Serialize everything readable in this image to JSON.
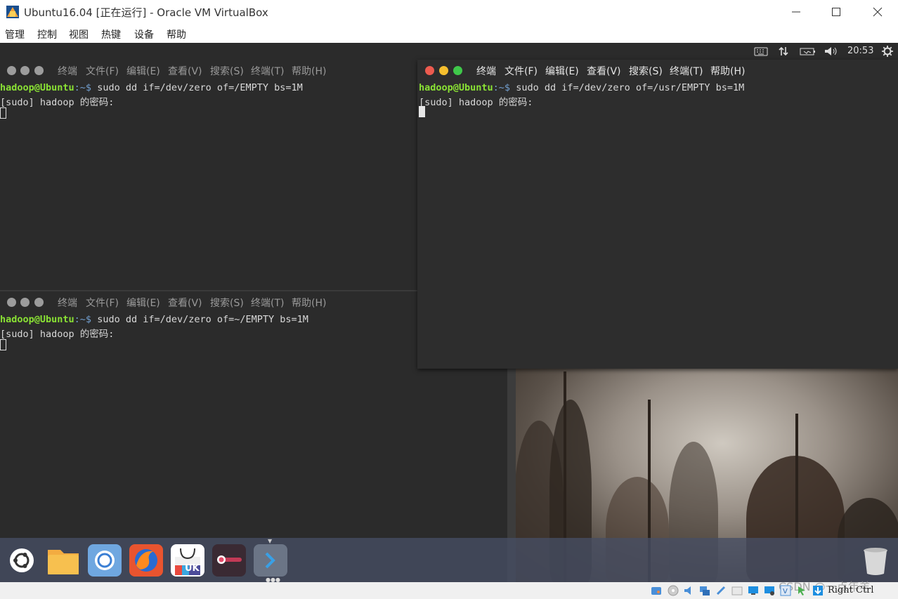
{
  "window": {
    "title": "Ubuntu16.04 [正在运行] - Oracle VM VirtualBox",
    "menu": [
      "管理",
      "控制",
      "视图",
      "热键",
      "设备",
      "帮助"
    ]
  },
  "panel": {
    "clock": "20:53"
  },
  "terminal_menu": [
    "终端",
    "文件(F)",
    "编辑(E)",
    "查看(V)",
    "搜索(S)",
    "终端(T)",
    "帮助(H)"
  ],
  "terminals": [
    {
      "prompt_user": "hadoop@Ubuntu",
      "prompt_path": ":~$",
      "command": " sudo dd if=/dev/zero of=/EMPTY bs=1M",
      "output": "[sudo] hadoop 的密码:"
    },
    {
      "prompt_user": "hadoop@Ubuntu",
      "prompt_path": ":~$",
      "command": " sudo dd if=/dev/zero of=~/EMPTY bs=1M",
      "output": "[sudo] hadoop 的密码:"
    },
    {
      "prompt_user": "hadoop@Ubuntu",
      "prompt_path": ":~$",
      "command": " sudo dd if=/dev/zero of=/usr/EMPTY bs=1M",
      "output": "[sudo] hadoop 的密码:"
    }
  ],
  "dock": {
    "badge": "UK"
  },
  "statusbar": {
    "host_key": "Right Ctrl",
    "watermark": "CSDN @一点年羊"
  },
  "colors": {
    "user_green": "#8ae234",
    "path_blue": "#729fcf",
    "close_red": "#ed5b4f",
    "min_yellow": "#f5be2e",
    "max_green": "#3fc84a"
  }
}
